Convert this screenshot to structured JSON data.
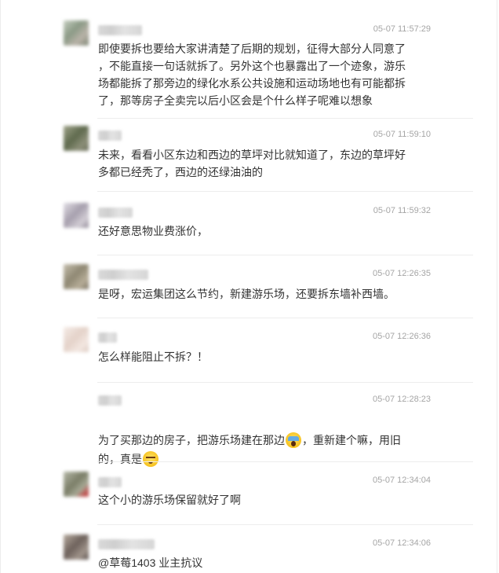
{
  "comments": [
    {
      "time": "05-07 11:57:29",
      "text": "即使要拆也要给大家讲清楚了后期的规划，征得大部分人同意了\n，不能直接一句话就拆了。另外这个也暴露出了一个迹象，游乐\n场都能拆了那旁边的绿化水系公共设施和运动场地也有可能都拆\n了，那等房子全卖完以后小区会是个什么样子呢难以想象",
      "avatar_color": "#9aa892"
    },
    {
      "time": "05-07 11:59:10",
      "text": "未来，看看小区东边和西边的草坪对比就知道了，东边的草坪好\n多都已经秃了，西边的还绿油油的",
      "avatar_color": "#6f7a60"
    },
    {
      "time": "05-07 11:59:32",
      "text": "还好意思物业费涨价，",
      "avatar_color": "#b8b2bd"
    },
    {
      "time": "05-07 12:26:35",
      "text": "是呀，宏运集团这么节约，新建游乐场，还要拆东墙补西墙。",
      "avatar_color": "#a39b87"
    },
    {
      "time": "05-07 12:26:36",
      "text": "怎么样能阻止不拆？！",
      "avatar_color": "#efe2dc"
    },
    {
      "time": "05-07 12:28:23",
      "text_a": "为了买那边的房子，把游乐场建在那边",
      "text_b": "，重新建个嘛，用旧\n的，真是",
      "emoji_a": "scream-icon",
      "emoji_b": "sleepy-icon"
    },
    {
      "time": "05-07 12:34:04",
      "text": "这个小的游乐场保留就好了啊",
      "avatar_color": "#8a8f7b"
    },
    {
      "time": "05-07 12:34:06",
      "text": "@草莓1403 业主抗议",
      "avatar_color": "#8c7f7a"
    }
  ]
}
